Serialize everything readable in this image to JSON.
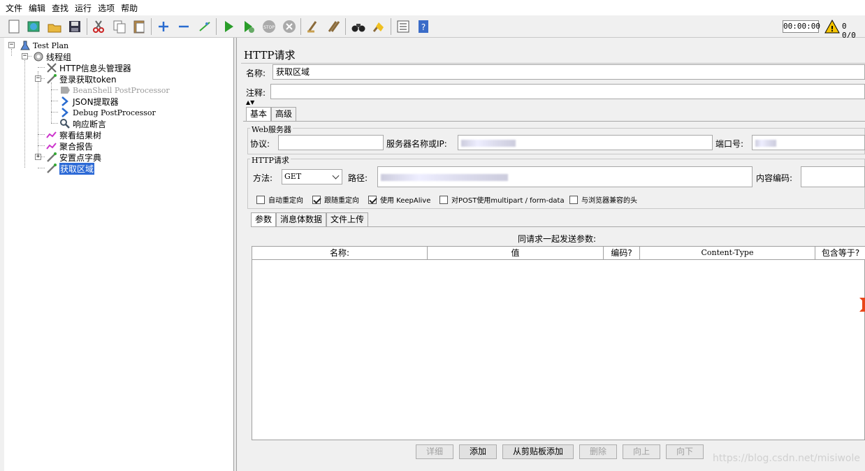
{
  "menu": [
    "文件",
    "编辑",
    "查找",
    "运行",
    "选项",
    "帮助"
  ],
  "toolbar": {
    "icons": [
      "new-icon",
      "templates-icon",
      "open-icon",
      "save-icon",
      "cut-icon",
      "copy-icon",
      "paste-icon",
      "expand-icon",
      "collapse-icon",
      "toggle-icon",
      "start-icon",
      "start-no-pause-icon",
      "stop-icon",
      "shutdown-icon",
      "clear-icon",
      "clear-all-icon",
      "search-icon",
      "reset-search-icon",
      "function-helper-icon",
      "help-icon"
    ],
    "timer": "00:00:00",
    "error_count": "0",
    "thread_count": "0/0"
  },
  "tree": [
    {
      "label": "Test Plan",
      "icon": "test-plan-icon",
      "cn": false
    },
    {
      "label": "线程组",
      "icon": "thread-group-icon",
      "cn": true
    },
    {
      "label": "HTTP信息头管理器",
      "icon": "header-manager-icon",
      "cn": true
    },
    {
      "label": "登录获取token",
      "icon": "sampler-icon",
      "cn": true
    },
    {
      "label": "BeanShell PostProcessor",
      "icon": "beanshell-icon",
      "cn": false,
      "disabled": true
    },
    {
      "label": "JSON提取器",
      "icon": "json-extractor-icon",
      "cn": true
    },
    {
      "label": "Debug PostProcessor",
      "icon": "debug-icon",
      "cn": false
    },
    {
      "label": "响应断言",
      "icon": "assertion-icon",
      "cn": true
    },
    {
      "label": "察看结果树",
      "icon": "result-tree-icon",
      "cn": true
    },
    {
      "label": "聚合报告",
      "icon": "aggregate-report-icon",
      "cn": true
    },
    {
      "label": "安置点字典",
      "icon": "sampler-icon",
      "cn": true
    },
    {
      "label": "获取区域",
      "icon": "sampler-icon",
      "cn": true,
      "selected": true
    }
  ],
  "panel": {
    "title": "HTTP请求",
    "name_label": "名称:",
    "name_value": "获取区域",
    "comment_label": "注释:",
    "comment_value": "",
    "tabs": [
      "基本",
      "高级"
    ],
    "web_server": {
      "group_title": "Web服务器",
      "protocol_label": "协议:",
      "protocol_value": "",
      "server_label": "服务器名称或IP:",
      "port_label": "端口号:"
    },
    "http_request": {
      "group_title": "HTTP请求",
      "method_label": "方法:",
      "method_value": "GET",
      "path_label": "路径:",
      "encoding_label": "内容编码:",
      "encoding_value": ""
    },
    "checkboxes": [
      {
        "label": "自动重定向",
        "checked": false
      },
      {
        "label": "跟随重定向",
        "checked": true
      },
      {
        "label": "使用 KeepAlive",
        "checked": true
      },
      {
        "label": "对POST使用multipart / form-data",
        "checked": false
      },
      {
        "label": "与浏览器兼容的头",
        "checked": false
      }
    ],
    "sub_tabs": [
      "参数",
      "消息体数据",
      "文件上传"
    ],
    "params_caption": "同请求一起发送参数:",
    "columns": [
      "名称:",
      "值",
      "编码?",
      "Content-Type",
      "包含等于?"
    ],
    "buttons": [
      {
        "label": "详细",
        "enabled": false
      },
      {
        "label": "添加",
        "enabled": true
      },
      {
        "label": "从剪贴板添加",
        "enabled": true
      },
      {
        "label": "删除",
        "enabled": false
      },
      {
        "label": "向上",
        "enabled": false
      },
      {
        "label": "向下",
        "enabled": false
      }
    ]
  },
  "watermark": "https://blog.csdn.net/misiwole"
}
